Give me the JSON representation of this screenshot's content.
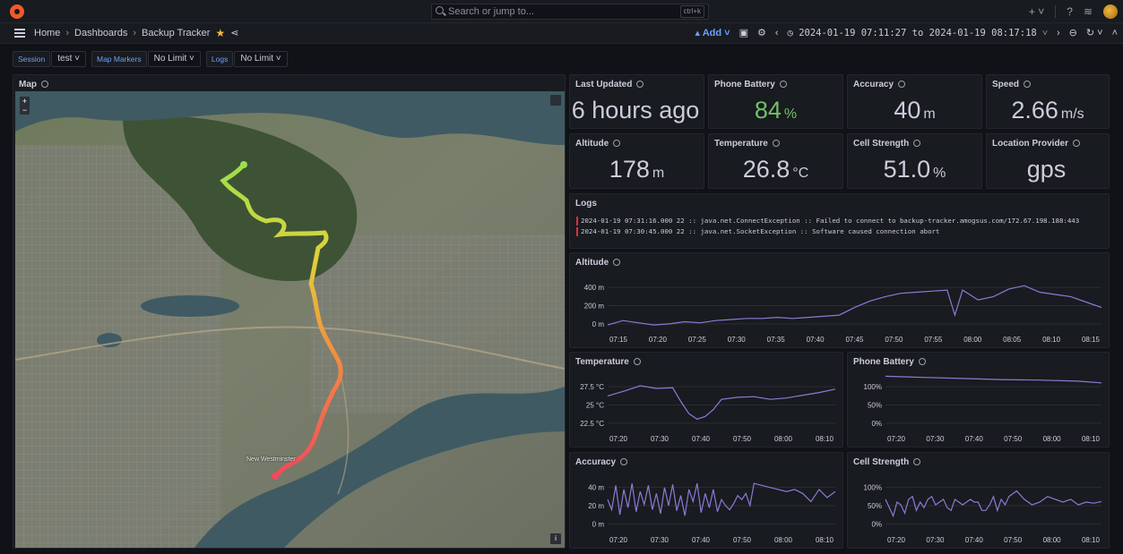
{
  "topbar": {
    "search_placeholder": "Search or jump to...",
    "search_shortcut": "ctrl+k",
    "plus_label": "+ ˅",
    "help_icon": "help-icon",
    "news_icon": "rss-icon"
  },
  "navbar": {
    "breadcrumbs": [
      "Home",
      "Dashboards",
      "Backup Tracker"
    ],
    "add_label": "Add",
    "time_range": "2024-01-19 07:11:27 to 2024-01-19 08:17:18"
  },
  "variables": [
    {
      "label": "Session",
      "value": "test"
    },
    {
      "label": "Map Markers",
      "value": "No Limit"
    },
    {
      "label": "Logs",
      "value": "No Limit"
    }
  ],
  "map": {
    "title": "Map",
    "city_labels": [
      "New Westminster"
    ]
  },
  "stats": [
    {
      "title": "Last Updated",
      "value": "6 hours ago",
      "unit": "",
      "color": "#ccccdc"
    },
    {
      "title": "Phone Battery",
      "value": "84",
      "unit": "%",
      "color": "#73bf69"
    },
    {
      "title": "Accuracy",
      "value": "40",
      "unit": "m",
      "color": "#ccccdc"
    },
    {
      "title": "Speed",
      "value": "2.66",
      "unit": "m/s",
      "color": "#ccccdc"
    },
    {
      "title": "Altitude",
      "value": "178",
      "unit": "m",
      "color": "#ccccdc"
    },
    {
      "title": "Temperature",
      "value": "26.8",
      "unit": "°C",
      "color": "#ccccdc"
    },
    {
      "title": "Cell Strength",
      "value": "51.0",
      "unit": "%",
      "color": "#ccccdc"
    },
    {
      "title": "Location Provider",
      "value": "gps",
      "unit": "",
      "color": "#ccccdc"
    }
  ],
  "logs": {
    "title": "Logs",
    "lines": [
      "2024-01-19 07:31:16.000 22 :: java.net.ConnectException :: Failed to connect to backup-tracker.amogsus.com/172.67.198.188:443",
      "2024-01-19 07:30:45.000 22 :: java.net.SocketException :: Software caused connection abort"
    ]
  },
  "colors": {
    "line": "#8c7ad6",
    "accent": "#6e9fff",
    "green": "#73bf69",
    "log_error": "#e0303c"
  },
  "chart_data": [
    {
      "type": "line",
      "title": "Altitude",
      "x_ticks": [
        "07:15",
        "07:20",
        "07:25",
        "07:30",
        "07:35",
        "07:40",
        "07:45",
        "07:50",
        "07:55",
        "08:00",
        "08:05",
        "08:10",
        "08:15"
      ],
      "y_ticks": [
        "0 m",
        "200 m",
        "400 m"
      ],
      "ylim": [
        0,
        500
      ],
      "x": [
        0,
        2,
        4,
        6,
        8,
        10,
        12,
        14,
        16,
        18,
        20,
        22,
        24,
        26,
        28,
        30,
        32,
        34,
        36,
        38,
        40,
        42,
        44,
        45,
        46,
        48,
        50,
        52,
        54,
        56,
        58,
        60,
        62,
        64
      ],
      "values": [
        40,
        80,
        60,
        40,
        50,
        70,
        60,
        80,
        90,
        100,
        100,
        110,
        100,
        110,
        120,
        130,
        200,
        260,
        300,
        330,
        340,
        350,
        360,
        130,
        360,
        270,
        300,
        370,
        400,
        340,
        320,
        300,
        250,
        200
      ]
    },
    {
      "type": "line",
      "title": "Temperature",
      "x_ticks": [
        "07:20",
        "07:30",
        "07:40",
        "07:50",
        "08:00",
        "08:10"
      ],
      "y_ticks": [
        "22.5 °C",
        "25 °C",
        "27.5 °C"
      ],
      "ylim": [
        21,
        29
      ],
      "x": [
        0,
        4,
        8,
        12,
        16,
        18,
        20,
        22,
        24,
        26,
        28,
        32,
        36,
        40,
        44,
        48,
        52,
        56
      ],
      "values": [
        25.8,
        26.5,
        27.3,
        26.9,
        27.0,
        25.0,
        23.2,
        22.4,
        22.8,
        23.8,
        25.3,
        25.6,
        25.7,
        25.3,
        25.5,
        25.9,
        26.3,
        26.8
      ]
    },
    {
      "type": "line",
      "title": "Phone Battery",
      "x_ticks": [
        "07:20",
        "07:30",
        "07:40",
        "07:50",
        "08:00",
        "08:10"
      ],
      "y_ticks": [
        "0%",
        "50%",
        "100%"
      ],
      "ylim": [
        0,
        100
      ],
      "x": [
        0,
        10,
        20,
        30,
        40,
        50,
        56
      ],
      "values": [
        96,
        94,
        92,
        90,
        89,
        87,
        84
      ]
    },
    {
      "type": "line",
      "title": "Accuracy",
      "x_ticks": [
        "07:20",
        "07:30",
        "07:40",
        "07:50",
        "08:00",
        "08:10"
      ],
      "y_ticks": [
        "0 m",
        "20 m",
        "40 m"
      ],
      "ylim": [
        0,
        55
      ],
      "x": [
        0,
        1,
        2,
        3,
        4,
        5,
        6,
        7,
        8,
        9,
        10,
        11,
        12,
        13,
        14,
        15,
        16,
        17,
        18,
        19,
        20,
        21,
        22,
        23,
        24,
        25,
        26,
        27,
        28,
        29,
        30,
        31,
        32,
        33,
        34,
        35,
        36,
        38,
        40,
        42,
        44,
        46,
        48,
        50,
        52,
        54,
        56
      ],
      "values": [
        30,
        20,
        44,
        15,
        40,
        22,
        46,
        18,
        38,
        25,
        44,
        20,
        36,
        16,
        42,
        24,
        45,
        19,
        34,
        14,
        40,
        28,
        46,
        17,
        36,
        22,
        40,
        18,
        30,
        24,
        20,
        26,
        34,
        30,
        36,
        24,
        46,
        44,
        42,
        40,
        38,
        40,
        36,
        28,
        40,
        32,
        38
      ]
    },
    {
      "type": "line",
      "title": "Cell Strength",
      "x_ticks": [
        "07:20",
        "07:30",
        "07:40",
        "07:50",
        "08:00",
        "08:10"
      ],
      "y_ticks": [
        "0%",
        "50%",
        "100%"
      ],
      "ylim": [
        0,
        100
      ],
      "x": [
        0,
        1,
        2,
        3,
        4,
        5,
        6,
        7,
        8,
        9,
        10,
        11,
        12,
        13,
        14,
        15,
        16,
        17,
        18,
        19,
        20,
        21,
        22,
        23,
        24,
        25,
        26,
        27,
        28,
        29,
        30,
        31,
        32,
        34,
        36,
        38,
        40,
        42,
        44,
        46,
        48,
        50,
        52,
        54,
        56
      ],
      "values": [
        55,
        40,
        25,
        50,
        45,
        30,
        55,
        60,
        35,
        50,
        40,
        55,
        60,
        45,
        50,
        55,
        40,
        35,
        55,
        50,
        45,
        50,
        55,
        50,
        50,
        35,
        35,
        45,
        60,
        35,
        55,
        45,
        60,
        70,
        55,
        45,
        50,
        60,
        55,
        50,
        55,
        45,
        50,
        48,
        51
      ]
    }
  ]
}
